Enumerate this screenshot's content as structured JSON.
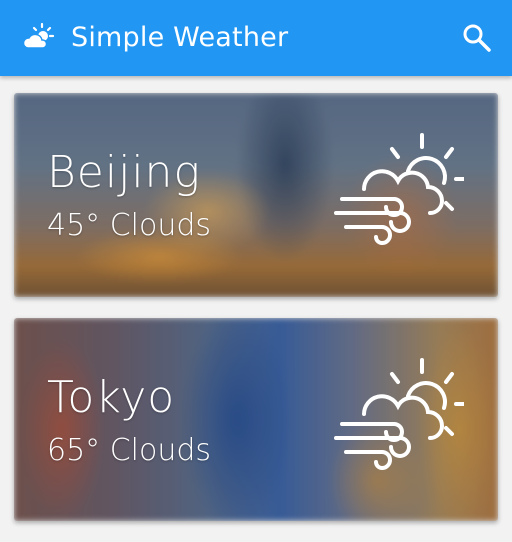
{
  "app": {
    "title": "Simple Weather",
    "logo_icon": "partly-cloudy-icon",
    "search_icon": "search-icon",
    "bar_color": "#2196f3"
  },
  "cards": [
    {
      "city": "Beijing",
      "temp_condition": "45° Clouds",
      "icon": "cloud-wind-sun-icon"
    },
    {
      "city": "Tokyo",
      "temp_condition": "65° Clouds",
      "icon": "cloud-wind-sun-icon"
    }
  ]
}
